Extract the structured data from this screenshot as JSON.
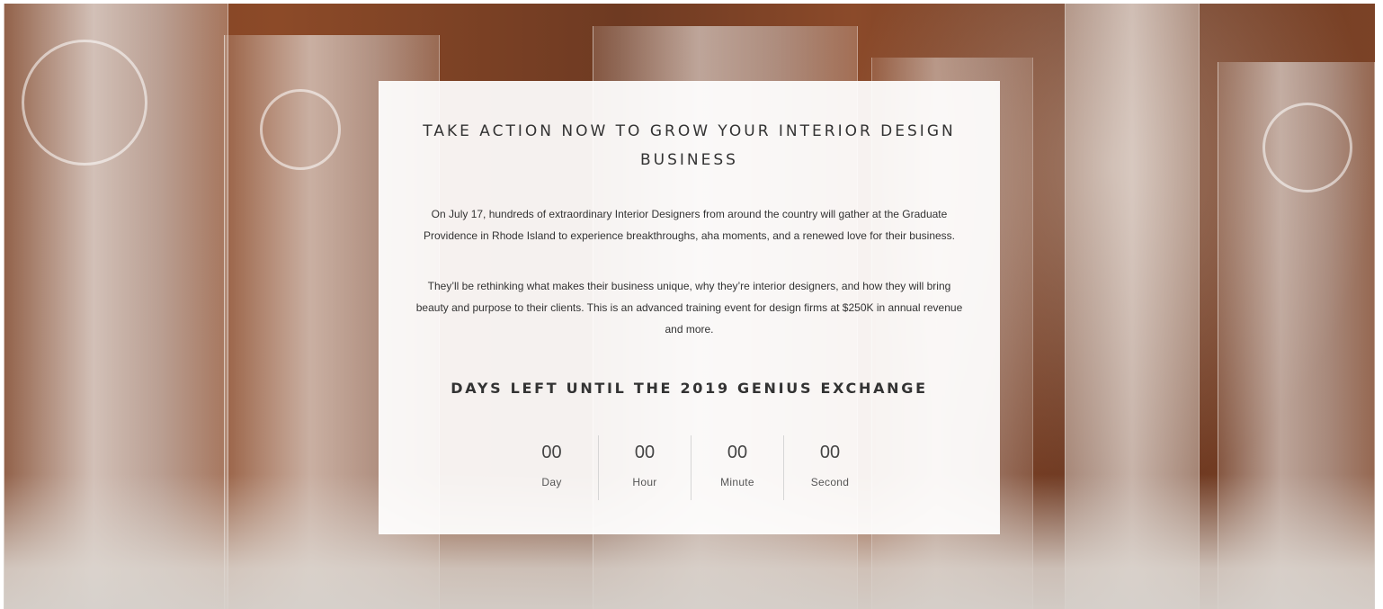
{
  "hero": {
    "headline": "TAKE ACTION NOW TO GROW YOUR INTERIOR DESIGN BUSINESS",
    "paragraphs": [
      "On July 17, hundreds of extraordinary Interior Designers from around the country will gather at the Graduate Providence in Rhode Island to experience breakthroughs, aha moments, and a renewed love for their business.",
      "They’ll be rethinking what makes their business unique, why they’re interior designers, and how they will bring beauty and purpose to their clients. This is an advanced training event for design firms at $250K in annual revenue and more."
    ],
    "countdown_title": "DAYS LEFT UNTIL THE 2019 GENIUS EXCHANGE",
    "countdown": [
      {
        "value": "00",
        "label": "Day"
      },
      {
        "value": "00",
        "label": "Hour"
      },
      {
        "value": "00",
        "label": "Minute"
      },
      {
        "value": "00",
        "label": "Second"
      }
    ]
  },
  "colors": {
    "background_wood": "#7a3f22",
    "card": "#ffffff",
    "text": "#333333",
    "divider": "#d6d6d6"
  }
}
